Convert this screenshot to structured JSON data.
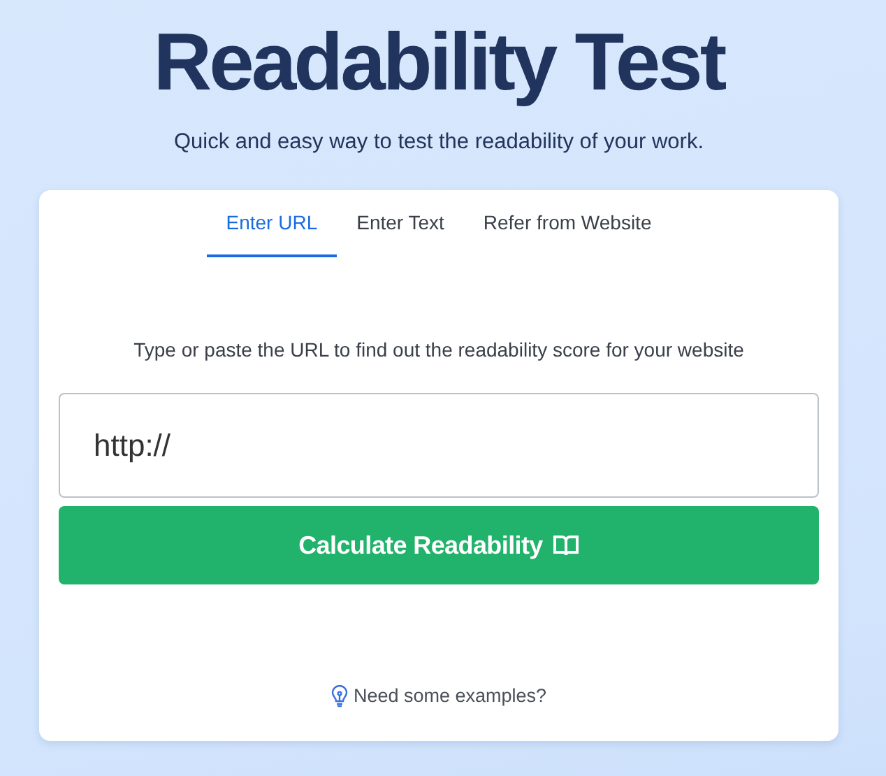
{
  "header": {
    "title": "Readability Test",
    "subtitle": "Quick and easy way to test the readability of your work."
  },
  "tabs": [
    {
      "label": "Enter URL",
      "selected": true
    },
    {
      "label": "Enter Text",
      "selected": false
    },
    {
      "label": "Refer from Website",
      "selected": false
    }
  ],
  "instruction": "Type or paste the URL to find out the readability score for your website",
  "url_field": {
    "value": "http://"
  },
  "submit_button": {
    "label": "Calculate Readability"
  },
  "examples_link": "Need some examples?"
}
